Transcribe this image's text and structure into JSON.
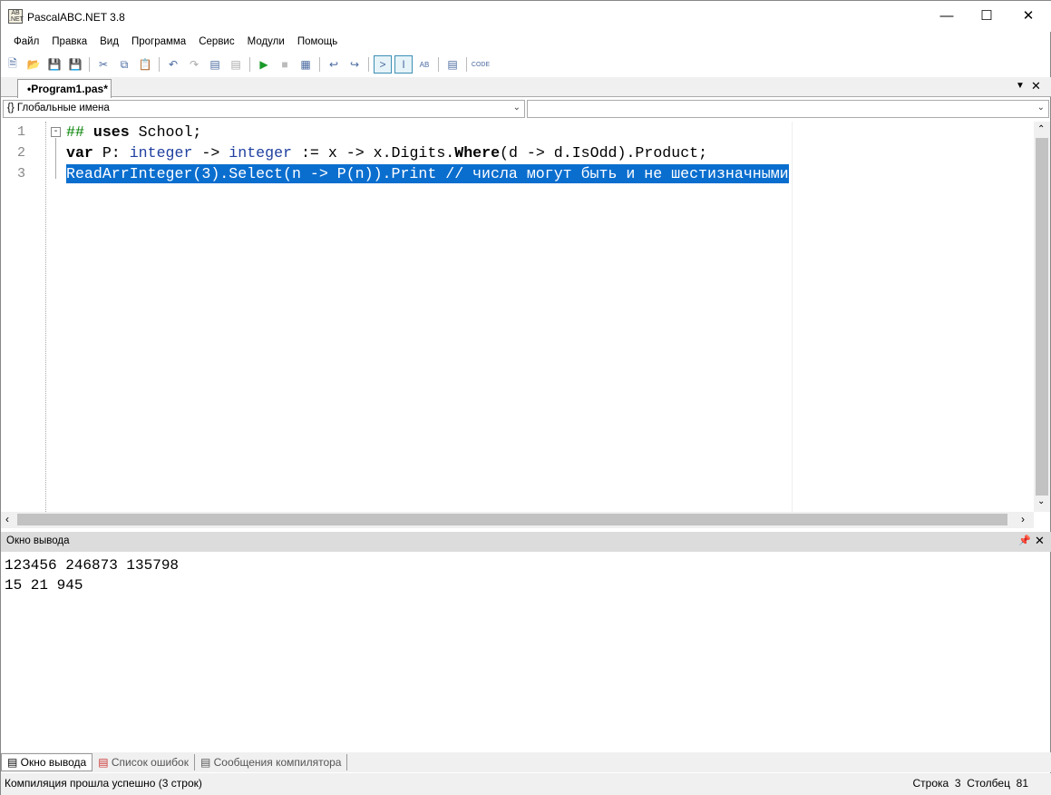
{
  "window": {
    "title": "PascalABC.NET 3.8",
    "app_icon_text": "AB .NET"
  },
  "menu": [
    "Файл",
    "Правка",
    "Вид",
    "Программа",
    "Сервис",
    "Модули",
    "Помощь"
  ],
  "toolbar": [
    "new",
    "open",
    "save",
    "save-all",
    "cut",
    "copy",
    "paste",
    "undo",
    "redo",
    "format",
    "format-next",
    "run",
    "stop",
    "debug",
    "step-over",
    "step-into",
    "output-window",
    "console",
    "spellcheck",
    "form",
    "code"
  ],
  "tab": {
    "label": "•Program1.pas*"
  },
  "combo": {
    "scope": "Глобальные имена",
    "member": ""
  },
  "editor": {
    "line_numbers": [
      "1",
      "2",
      "3"
    ],
    "line1": {
      "pre": "## ",
      "kw": "uses",
      "post": " School;"
    },
    "line2": {
      "kw": "var",
      "a": " P: ",
      "t1": "integer",
      "b": " -> ",
      "t2": "integer",
      "c": " := x -> x.Digits.",
      "kw2": "Where",
      "d": "(d -> d.IsOdd).Product;"
    },
    "line3": "ReadArrInteger(3).Select(n -> P(n)).Print // числа могут быть и не шестизначными"
  },
  "output": {
    "title": "Окно вывода",
    "lines": [
      "123456 246873 135798",
      "15 21 945"
    ]
  },
  "bottom_tabs": [
    "Окно вывода",
    "Список ошибок",
    "Сообщения компилятора"
  ],
  "status": {
    "message": "Компиляция прошла успешно (3 строк)",
    "row_label": "Строка",
    "row": "3",
    "col_label": "Столбец",
    "col": "81"
  }
}
